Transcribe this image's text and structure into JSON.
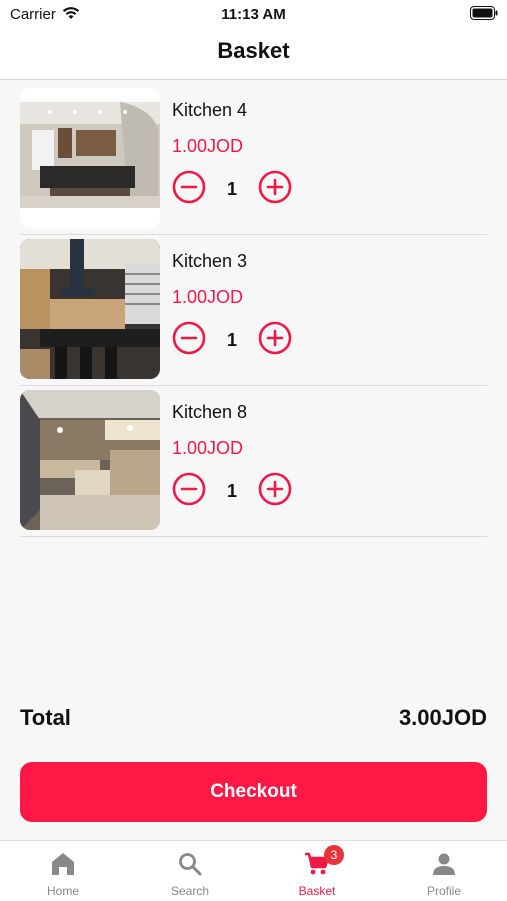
{
  "status_bar": {
    "carrier": "Carrier",
    "time": "11:13 AM"
  },
  "header": {
    "title": "Basket"
  },
  "items": [
    {
      "name": "Kitchen 4",
      "price": "1.00JOD",
      "quantity": "1"
    },
    {
      "name": "Kitchen 3",
      "price": "1.00JOD",
      "quantity": "1"
    },
    {
      "name": "Kitchen 8",
      "price": "1.00JOD",
      "quantity": "1"
    }
  ],
  "total": {
    "label": "Total",
    "value": "3.00JOD"
  },
  "checkout": {
    "label": "Checkout"
  },
  "tabs": [
    {
      "label": "Home",
      "icon": "home-icon",
      "active": false
    },
    {
      "label": "Search",
      "icon": "search-icon",
      "active": false
    },
    {
      "label": "Basket",
      "icon": "cart-icon",
      "active": true,
      "badge": "3"
    },
    {
      "label": "Profile",
      "icon": "person-icon",
      "active": false
    }
  ],
  "colors": {
    "accent": "#ff1745",
    "price": "#ef1948",
    "inactive_tab": "#888888"
  }
}
